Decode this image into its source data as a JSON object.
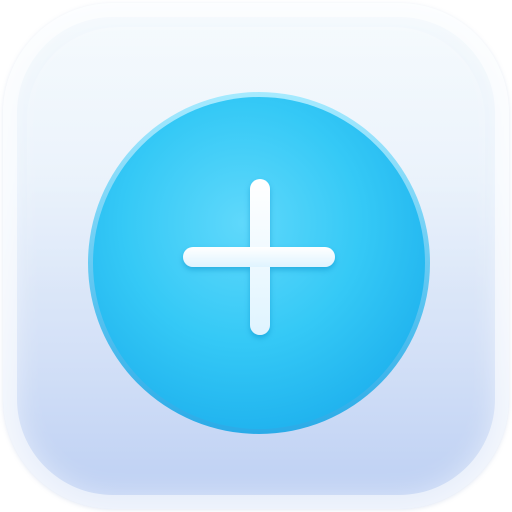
{
  "app_icon": {
    "name": "add",
    "symbol": "plus-icon"
  },
  "colors": {
    "icon_background_top": "#f3f9fd",
    "icon_background_bottom": "#bccff3",
    "button_fill": "#2ec7f5",
    "button_fill_light": "#5ed6fa",
    "button_fill_dark": "#1fb3ef",
    "plus_color": "#f4fbff"
  }
}
